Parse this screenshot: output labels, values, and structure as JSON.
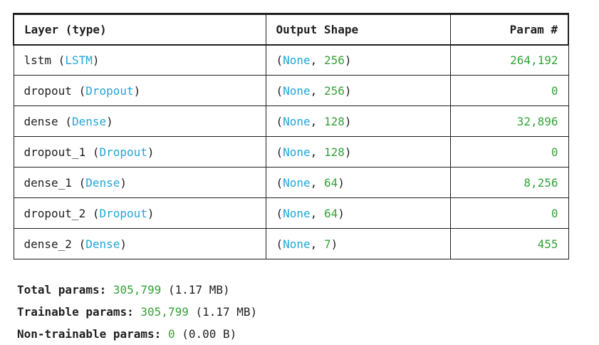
{
  "table": {
    "headers": [
      "Layer (type)",
      "Output Shape",
      "Param #"
    ],
    "rows": [
      {
        "name": "lstm",
        "type": "LSTM",
        "shape_first": "None",
        "shape_second": "256",
        "params": "264,192"
      },
      {
        "name": "dropout",
        "type": "Dropout",
        "shape_first": "None",
        "shape_second": "256",
        "params": "0"
      },
      {
        "name": "dense",
        "type": "Dense",
        "shape_first": "None",
        "shape_second": "128",
        "params": "32,896"
      },
      {
        "name": "dropout_1",
        "type": "Dropout",
        "shape_first": "None",
        "shape_second": "128",
        "params": "0"
      },
      {
        "name": "dense_1",
        "type": "Dense",
        "shape_first": "None",
        "shape_second": "64",
        "params": "8,256"
      },
      {
        "name": "dropout_2",
        "type": "Dropout",
        "shape_first": "None",
        "shape_second": "64",
        "params": "0"
      },
      {
        "name": "dense_2",
        "type": "Dense",
        "shape_first": "None",
        "shape_second": "7",
        "params": "455"
      }
    ]
  },
  "summary": {
    "total": {
      "label": "Total params:",
      "value": "305,799",
      "size": "(1.17 MB)"
    },
    "trainable": {
      "label": "Trainable params:",
      "value": "305,799",
      "size": "(1.17 MB)"
    },
    "non_trainable": {
      "label": "Non-trainable params:",
      "value": "0",
      "size": "(0.00 B)"
    }
  },
  "colors": {
    "type_blue": "#1fa6d8",
    "number_green": "#35a23a",
    "text": "#1f1f1f"
  }
}
